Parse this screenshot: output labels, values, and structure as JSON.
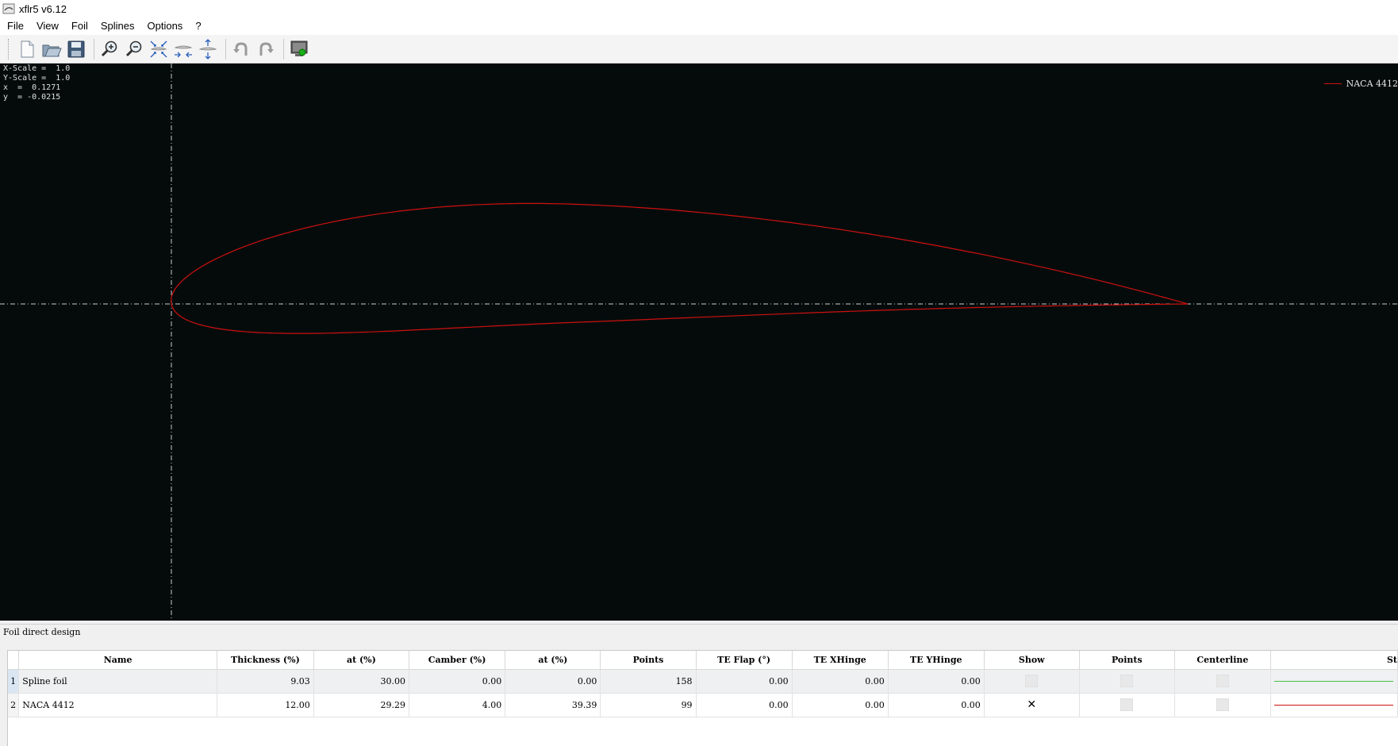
{
  "window": {
    "title": "xflr5 v6.12"
  },
  "menu": [
    "File",
    "View",
    "Foil",
    "Splines",
    "Options",
    "?"
  ],
  "toolbar": {
    "buttons": [
      {
        "icon": "new-file-icon"
      },
      {
        "icon": "open-folder-icon"
      },
      {
        "icon": "save-icon"
      },
      {
        "icon": "zoom-in-icon"
      },
      {
        "icon": "zoom-out-icon"
      },
      {
        "icon": "reset-scale-icon"
      },
      {
        "icon": "x-scale-icon"
      },
      {
        "icon": "y-scale-icon"
      },
      {
        "icon": "undo-icon"
      },
      {
        "icon": "redo-icon"
      },
      {
        "icon": "screenshot-icon"
      }
    ]
  },
  "plot": {
    "scale_x": "X-Scale =  1.0",
    "scale_y": "Y-Scale =  1.0",
    "cursor_x": "x  =  0.1271",
    "cursor_y": "y  = -0.0215",
    "legend_label": "NACA 4412",
    "foil_color": "#d01010",
    "axis_color": "#c8c8c8"
  },
  "dock": {
    "title": "Foil direct design",
    "columns": [
      "Name",
      "Thickness (%)",
      "at (%)",
      "Camber (%)",
      "at (%)",
      "Points",
      "TE Flap (°)",
      "TE XHinge",
      "TE YHinge",
      "Show",
      "Points",
      "Centerline",
      "St"
    ],
    "rows": [
      {
        "index": "1",
        "name": "Spline foil",
        "thickness": "9.03",
        "thickness_at": "30.00",
        "camber": "0.00",
        "camber_at": "0.00",
        "points": "158",
        "te_flap": "0.00",
        "te_xhinge": "0.00",
        "te_yhinge": "0.00",
        "show": false,
        "show_points": false,
        "centerline": false,
        "style_color": "#44c044"
      },
      {
        "index": "2",
        "name": "NACA 4412",
        "thickness": "12.00",
        "thickness_at": "29.29",
        "camber": "4.00",
        "camber_at": "39.39",
        "points": "99",
        "te_flap": "0.00",
        "te_xhinge": "0.00",
        "te_yhinge": "0.00",
        "show": true,
        "show_points": false,
        "centerline": false,
        "style_color": "#d01010"
      }
    ]
  }
}
